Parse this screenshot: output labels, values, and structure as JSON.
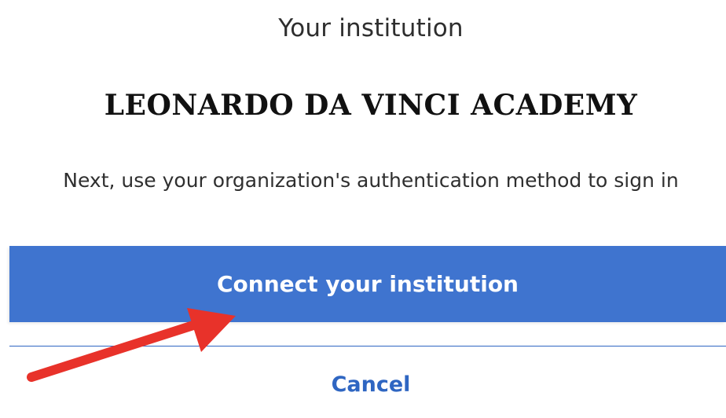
{
  "header": {
    "title": "Your institution"
  },
  "institution": {
    "name": "LEONARDO DA VINCI ACADEMY"
  },
  "instructions": {
    "text": "Next, use your organization's authentication method to sign in"
  },
  "actions": {
    "connect_label": "Connect your institution",
    "cancel_label": "Cancel"
  },
  "annotation": {
    "icon": "red-arrow-icon"
  },
  "colors": {
    "primary": "#3f74cf",
    "button_text": "#ffffff",
    "link": "#2f66c2",
    "divider": "#2f66c2",
    "arrow": "#e8322a",
    "heading": "#2e2e2e",
    "institution_name": "#111111"
  }
}
